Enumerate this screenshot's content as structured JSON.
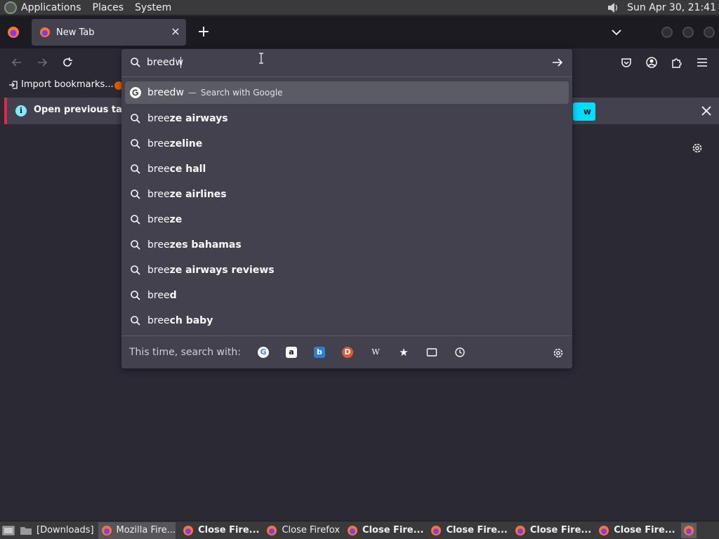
{
  "top_panel": {
    "menus": [
      "Applications",
      "Places",
      "System"
    ],
    "clock": "Sun Apr 30, 21:41"
  },
  "tabs": [
    {
      "title": "New Tab"
    }
  ],
  "bookmarks": {
    "import_label": "Import bookmarks..."
  },
  "notification": {
    "text": "Open previous tabs?",
    "button_label": "w"
  },
  "urlbar": {
    "value": "breedw",
    "first_suggestion": {
      "typed": "breedw",
      "separator": "—",
      "action": "Search with Google"
    },
    "suggestions": [
      {
        "typed": "bree",
        "rest": "ze airways"
      },
      {
        "typed": "bree",
        "rest": "zeline"
      },
      {
        "typed": "bree",
        "rest": "ce hall"
      },
      {
        "typed": "bree",
        "rest": "ze airlines"
      },
      {
        "typed": "bree",
        "rest": "ze"
      },
      {
        "typed": "bree",
        "rest": "zes bahamas"
      },
      {
        "typed": "bree",
        "rest": "ze airways reviews"
      },
      {
        "typed": "bree",
        "rest": "d"
      },
      {
        "typed": "bree",
        "rest": "ch baby"
      }
    ],
    "footer_label": "This time, search with:",
    "engines": [
      {
        "name": "google-icon",
        "glyph": "G"
      },
      {
        "name": "amazon-icon",
        "glyph": "a"
      },
      {
        "name": "bing-icon",
        "glyph": "b"
      },
      {
        "name": "duckduckgo-icon",
        "glyph": "D"
      },
      {
        "name": "wikipedia-icon",
        "glyph": "W"
      },
      {
        "name": "bookmarks-icon",
        "glyph": "★"
      },
      {
        "name": "tabs-icon",
        "glyph": ""
      },
      {
        "name": "history-icon",
        "glyph": ""
      }
    ]
  },
  "taskbar": {
    "items": [
      {
        "label": "[Downloads]",
        "type": "folder"
      },
      {
        "label": "Mozilla Fire...",
        "type": "ff",
        "active": true
      },
      {
        "label": "Close Fire...",
        "type": "ff",
        "bold": true
      },
      {
        "label": "Close Firefox",
        "type": "ff"
      },
      {
        "label": "Close Fire...",
        "type": "ff",
        "bold": true
      },
      {
        "label": "Close Fire...",
        "type": "ff",
        "bold": true
      },
      {
        "label": "Close Fire...",
        "type": "ff",
        "bold": true
      },
      {
        "label": "Close Fire...",
        "type": "ff",
        "bold": true
      }
    ]
  },
  "colors": {
    "accent": "#00ddff",
    "background": "#2b2a33",
    "panel": "#42414d",
    "selected": "#5b5b66"
  }
}
